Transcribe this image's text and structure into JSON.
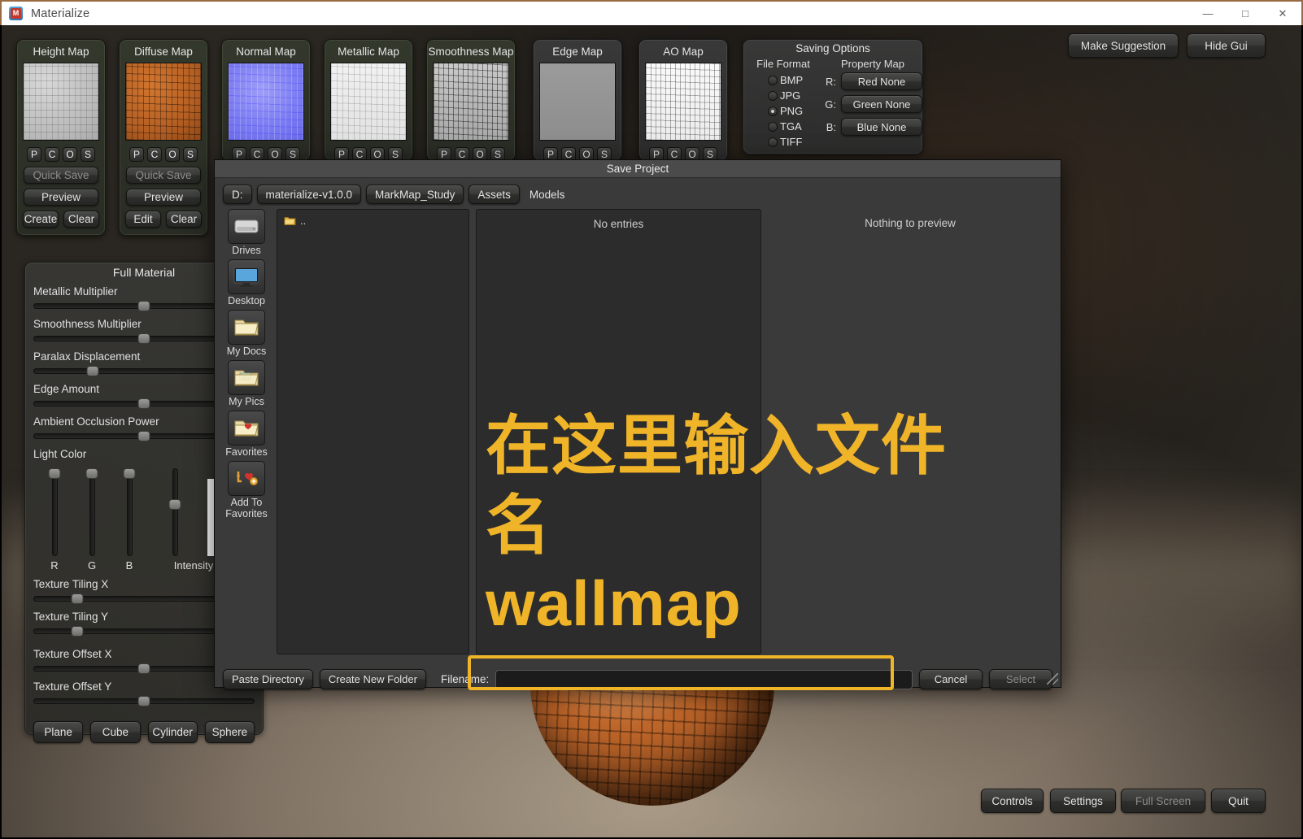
{
  "window": {
    "title": "Materialize",
    "icon": "app-icon",
    "minimize": "—",
    "maximize": "□",
    "close": "✕"
  },
  "maps": [
    {
      "name": "Height Map",
      "style": "green",
      "thumb": "tex-height",
      "toggles": [
        "P",
        "C",
        "O",
        "S"
      ],
      "quick_save": "Quick Save",
      "preview": "Preview",
      "action": "Create",
      "clear": "Clear"
    },
    {
      "name": "Diffuse Map",
      "style": "green",
      "thumb": "tex-diffuse",
      "toggles": [
        "P",
        "C",
        "O",
        "S"
      ],
      "quick_save": "Quick Save",
      "preview": "Preview",
      "action": "Edit",
      "clear": "Clear"
    },
    {
      "name": "Normal Map",
      "style": "green",
      "thumb": "tex-normal",
      "toggles": [
        "P",
        "C",
        "O",
        "S"
      ]
    },
    {
      "name": "Metallic Map",
      "style": "green",
      "thumb": "tex-metallic",
      "toggles": [
        "P",
        "C",
        "O",
        "S"
      ]
    },
    {
      "name": "Smoothness Map",
      "style": "green",
      "thumb": "tex-smooth",
      "toggles": [
        "P",
        "C",
        "O",
        "S"
      ]
    },
    {
      "name": "Edge Map",
      "style": "grey",
      "thumb": "tex-edge",
      "toggles": [
        "P",
        "C",
        "O",
        "S"
      ]
    },
    {
      "name": "AO Map",
      "style": "grey",
      "thumb": "tex-ao",
      "toggles": [
        "P",
        "C",
        "O",
        "S"
      ]
    }
  ],
  "saving_options": {
    "title": "Saving Options",
    "file_format_label": "File Format",
    "property_map_label": "Property Map",
    "formats": [
      {
        "label": "BMP",
        "selected": false
      },
      {
        "label": "JPG",
        "selected": false
      },
      {
        "label": "PNG",
        "selected": true
      },
      {
        "label": "TGA",
        "selected": false
      },
      {
        "label": "TIFF",
        "selected": false
      }
    ],
    "channels": [
      {
        "label": "R:",
        "value": "Red None"
      },
      {
        "label": "G:",
        "value": "Green None"
      },
      {
        "label": "B:",
        "value": "Blue None"
      }
    ]
  },
  "full_material": {
    "title": "Full Material",
    "sliders": [
      {
        "label": "Metallic Multiplier",
        "pct": 50
      },
      {
        "label": "Smoothness Multiplier",
        "pct": 50
      },
      {
        "label": "Paralax Displacement",
        "pct": 27
      },
      {
        "label": "Edge Amount",
        "pct": 50
      },
      {
        "label": "Ambient Occlusion Power",
        "pct": 50
      }
    ],
    "light_color": {
      "label": "Light Color",
      "channels": [
        {
          "label": "R",
          "pct": 100
        },
        {
          "label": "G",
          "pct": 100
        },
        {
          "label": "B",
          "pct": 100
        },
        {
          "label": "Intensity",
          "pct": 65
        }
      ],
      "swatch_color": "#ffffff"
    },
    "tiling": [
      {
        "label": "Texture Tiling X",
        "pct": 20
      },
      {
        "label": "Texture Tiling Y",
        "pct": 20
      }
    ],
    "offset": [
      {
        "label": "Texture Offset X",
        "pct": 50
      },
      {
        "label": "Texture Offset Y",
        "pct": 50
      }
    ],
    "shapes": [
      "Plane",
      "Cube",
      "Cylinder",
      "Sphere"
    ]
  },
  "top_buttons": {
    "make_suggestion": "Make Suggestion",
    "hide_gui": "Hide Gui"
  },
  "bottom_buttons": {
    "controls": "Controls",
    "settings": "Settings",
    "full_screen": "Full Screen",
    "quit": "Quit"
  },
  "dialog": {
    "title": "Save Project",
    "breadcrumbs": [
      {
        "label": "D:",
        "is_button": true
      },
      {
        "label": "materialize-v1.0.0",
        "is_button": true
      },
      {
        "label": "MarkMap_Study",
        "is_button": true
      },
      {
        "label": "Assets",
        "is_button": true
      },
      {
        "label": "Models",
        "is_button": false
      }
    ],
    "shortcuts": [
      {
        "label": "Drives",
        "icon": "drive-icon"
      },
      {
        "label": "Desktop",
        "icon": "monitor-icon"
      },
      {
        "label": "My Docs",
        "icon": "folder-icon"
      },
      {
        "label": "My Pics",
        "icon": "folder-pictures-icon"
      },
      {
        "label": "Favorites",
        "icon": "folder-heart-icon"
      },
      {
        "label": "Add To Favorites",
        "icon": "add-favorite-icon"
      }
    ],
    "dir_entries": [
      ".."
    ],
    "file_list_empty": "No entries",
    "preview_empty": "Nothing to preview",
    "paste_directory": "Paste Directory",
    "create_new_folder": "Create New Folder",
    "filename_label": "Filename:",
    "filename_value": "",
    "filename_placeholder": "",
    "cancel": "Cancel",
    "select": "Select"
  },
  "annotation": {
    "line1": "在这里输入文件名",
    "line2": "wallmap",
    "color": "#f0b429"
  }
}
